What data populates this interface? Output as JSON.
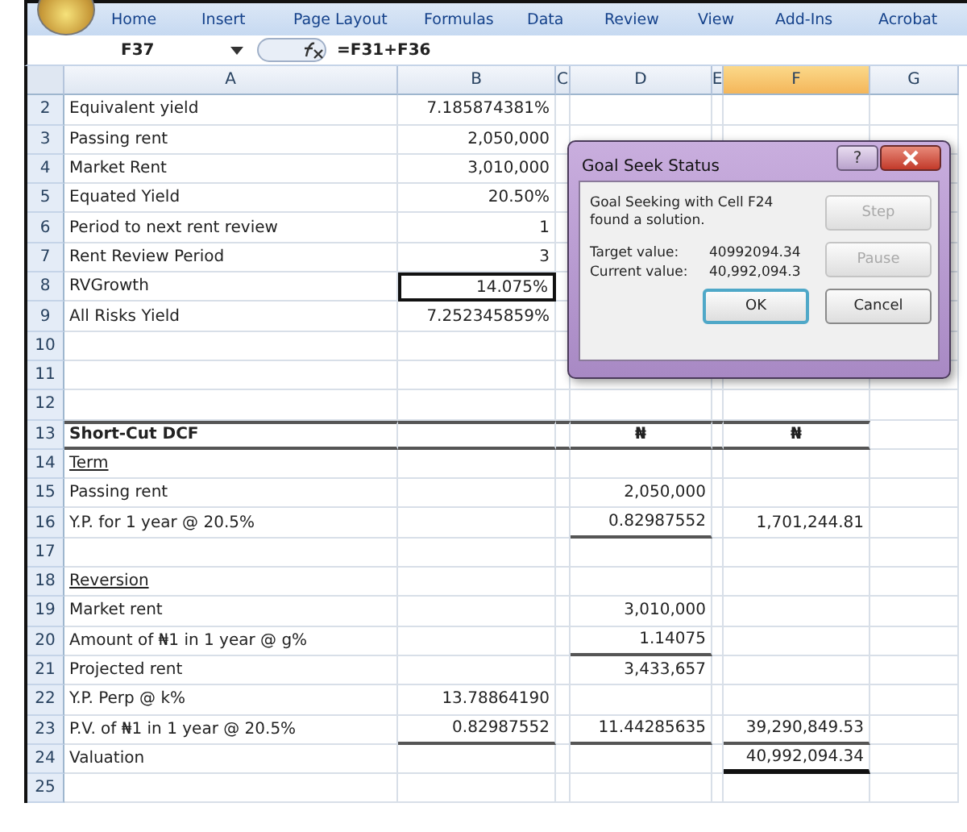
{
  "ribbon": {
    "tabs": [
      {
        "label": "Home",
        "selected": false
      },
      {
        "label": "Insert",
        "selected": false
      },
      {
        "label": "Page Layout",
        "selected": false
      },
      {
        "label": "Formulas",
        "selected": false
      },
      {
        "label": "Data",
        "selected": false
      },
      {
        "label": "Review",
        "selected": false
      },
      {
        "label": "View",
        "selected": false
      },
      {
        "label": "Add-Ins",
        "selected": false
      },
      {
        "label": "Acrobat",
        "selected": false
      }
    ]
  },
  "formula_bar": {
    "name_box": "F37",
    "formula": "=F31+F36"
  },
  "columns": [
    {
      "label": "A",
      "selected": false
    },
    {
      "label": "B",
      "selected": false
    },
    {
      "label": "C",
      "selected": false
    },
    {
      "label": "D",
      "selected": false
    },
    {
      "label": "E",
      "selected": false
    },
    {
      "label": "F",
      "selected": true
    },
    {
      "label": "G",
      "selected": false
    }
  ],
  "rows": [
    {
      "number": "2",
      "cells": {
        "a": {
          "text": "Equivalent yield"
        },
        "b": {
          "text": "7.185874381%"
        }
      }
    },
    {
      "number": "3",
      "cells": {
        "a": {
          "text": "Passing rent"
        },
        "b": {
          "text": "2,050,000"
        }
      }
    },
    {
      "number": "4",
      "cells": {
        "a": {
          "text": "Market Rent"
        },
        "b": {
          "text": "3,010,000"
        }
      }
    },
    {
      "number": "5",
      "cells": {
        "a": {
          "text": "Equated Yield"
        },
        "b": {
          "text": "20.50%"
        }
      }
    },
    {
      "number": "6",
      "cells": {
        "a": {
          "text": "Period to next rent review"
        },
        "b": {
          "text": "1"
        }
      }
    },
    {
      "number": "7",
      "cells": {
        "a": {
          "text": "Rent Review Period"
        },
        "b": {
          "text": "3"
        }
      }
    },
    {
      "number": "8",
      "cells": {
        "a": {
          "text": "RVGrowth"
        },
        "b": {
          "text": "14.075%",
          "outlined": true
        }
      }
    },
    {
      "number": "9",
      "cells": {
        "a": {
          "text": "All Risks Yield"
        },
        "b": {
          "text": "7.252345859%"
        }
      }
    },
    {
      "number": "10",
      "cells": {}
    },
    {
      "number": "11",
      "cells": {}
    },
    {
      "number": "12",
      "cells": {}
    },
    {
      "number": "13",
      "kind": "heading",
      "cells": {
        "a": {
          "text": "Short-Cut DCF"
        },
        "d": {
          "text": "₦"
        },
        "f": {
          "text": "₦"
        }
      }
    },
    {
      "number": "14",
      "kind": "subheading",
      "cells": {
        "a": {
          "text": "Term"
        }
      }
    },
    {
      "number": "15",
      "cells": {
        "a": {
          "text": "Passing rent"
        },
        "d": {
          "text": "2,050,000"
        }
      }
    },
    {
      "number": "16",
      "cells": {
        "a": {
          "text": "Y.P. for 1 year @ 20.5%"
        },
        "d": {
          "text": "0.82987552",
          "rule_below": true
        },
        "f": {
          "text": "1,701,244.81"
        }
      }
    },
    {
      "number": "17",
      "cells": {}
    },
    {
      "number": "18",
      "kind": "subheading",
      "cells": {
        "a": {
          "text": "Reversion"
        }
      }
    },
    {
      "number": "19",
      "cells": {
        "a": {
          "text": "Market rent"
        },
        "d": {
          "text": "3,010,000"
        }
      }
    },
    {
      "number": "20",
      "cells": {
        "a": {
          "text": "Amount of ₦1 in 1 year @ g%"
        },
        "d": {
          "text": "1.14075",
          "rule_below": true
        }
      }
    },
    {
      "number": "21",
      "cells": {
        "a": {
          "text": "Projected rent"
        },
        "d": {
          "text": "3,433,657"
        }
      }
    },
    {
      "number": "22",
      "cells": {
        "a": {
          "text": "Y.P. Perp @ k%"
        },
        "b": {
          "text": "13.78864190"
        }
      }
    },
    {
      "number": "23",
      "cells": {
        "a": {
          "text": "P.V. of ₦1 in 1 year @ 20.5%"
        },
        "b": {
          "text": "0.82987552",
          "rule_below": true
        },
        "d": {
          "text": "11.44285635",
          "rule_below": true
        },
        "f": {
          "text": "39,290,849.53",
          "rule_below": true
        }
      }
    },
    {
      "number": "24",
      "cells": {
        "a": {
          "text": "Valuation"
        },
        "f": {
          "text": "40,992,094.34",
          "heavy_rule_below": true
        }
      }
    },
    {
      "number": "25",
      "cells": {}
    }
  ],
  "dialog": {
    "title": "Goal Seek Status",
    "help": "?",
    "message": "Goal Seeking with Cell F24 found a solution.",
    "target_label": "Target value:",
    "target_value": "40992094.34",
    "current_label": "Current value:",
    "current_value": "40,992,094.3",
    "buttons": [
      {
        "label": "Step",
        "disabled": true,
        "selected": false
      },
      {
        "label": "Pause",
        "disabled": true,
        "selected": false
      },
      {
        "label": "OK",
        "disabled": false,
        "selected": true
      },
      {
        "label": "Cancel",
        "disabled": false,
        "selected": false
      }
    ]
  }
}
